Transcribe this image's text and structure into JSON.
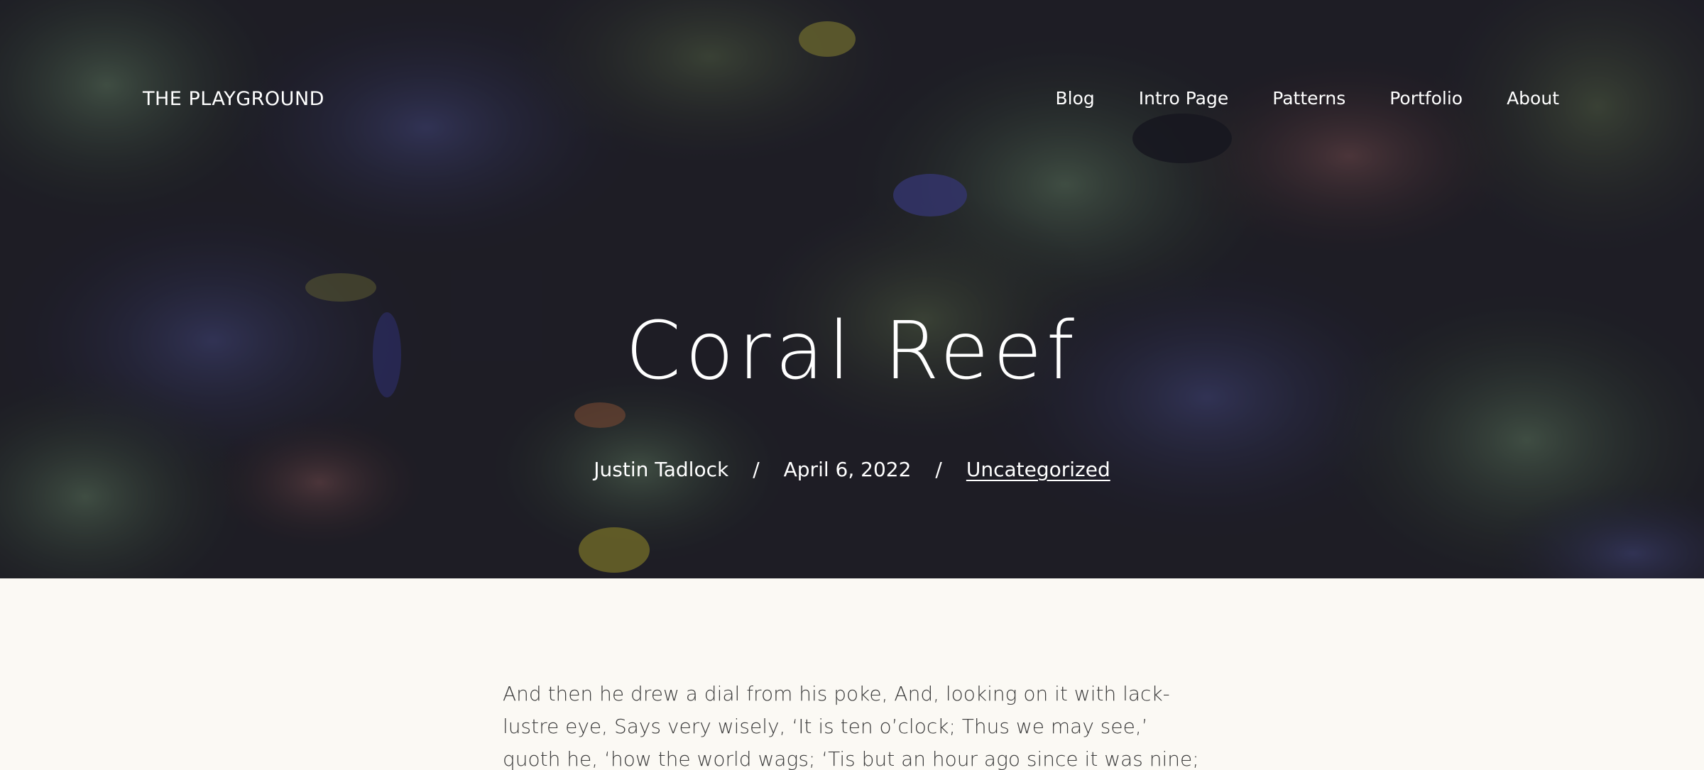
{
  "site": {
    "title": "THE PLAYGROUND"
  },
  "nav": {
    "items": [
      {
        "label": "Blog"
      },
      {
        "label": "Intro Page"
      },
      {
        "label": "Patterns"
      },
      {
        "label": "Portfolio"
      },
      {
        "label": "About"
      }
    ]
  },
  "post": {
    "title": "Coral Reef",
    "author": "Justin Tadlock",
    "date": "April 6, 2022",
    "category": "Uncategorized",
    "separator": "/",
    "body": "And then he drew a dial from his poke, And, looking on it with lack-lustre eye, Says very wisely, ‘It is ten o’clock; Thus we may see,’ quoth he, ‘how the world wags; ‘Tis but an hour ago since it was nine;"
  },
  "colors": {
    "background": "#fbf9f4",
    "hero_overlay": "#181620",
    "text": "#3a3a3a",
    "hero_text": "#ffffff"
  }
}
